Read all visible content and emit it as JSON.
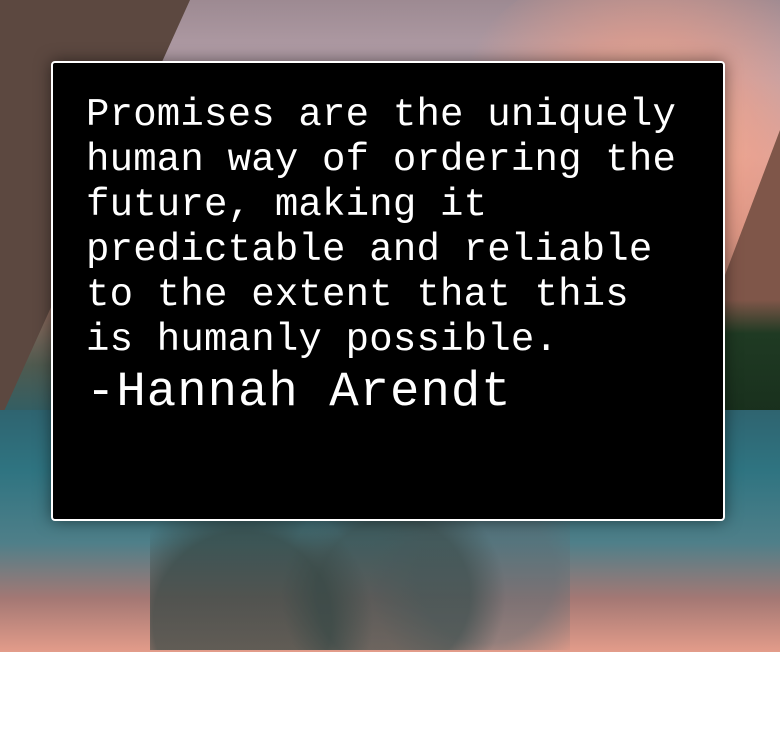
{
  "scene": {
    "background_theme": "mountain lake at sunset",
    "accent_colors": {
      "sky": "#d7a7a2",
      "water": "#2f7481",
      "card": "#000000",
      "text": "#ffffff"
    }
  },
  "quote": {
    "text": "Promises are the uniquely\nhuman way of ordering the\nfuture, making it\npredictable and reliable\nto the extent that this\nis humanly possible.",
    "author": "-Hannah Arendt"
  }
}
